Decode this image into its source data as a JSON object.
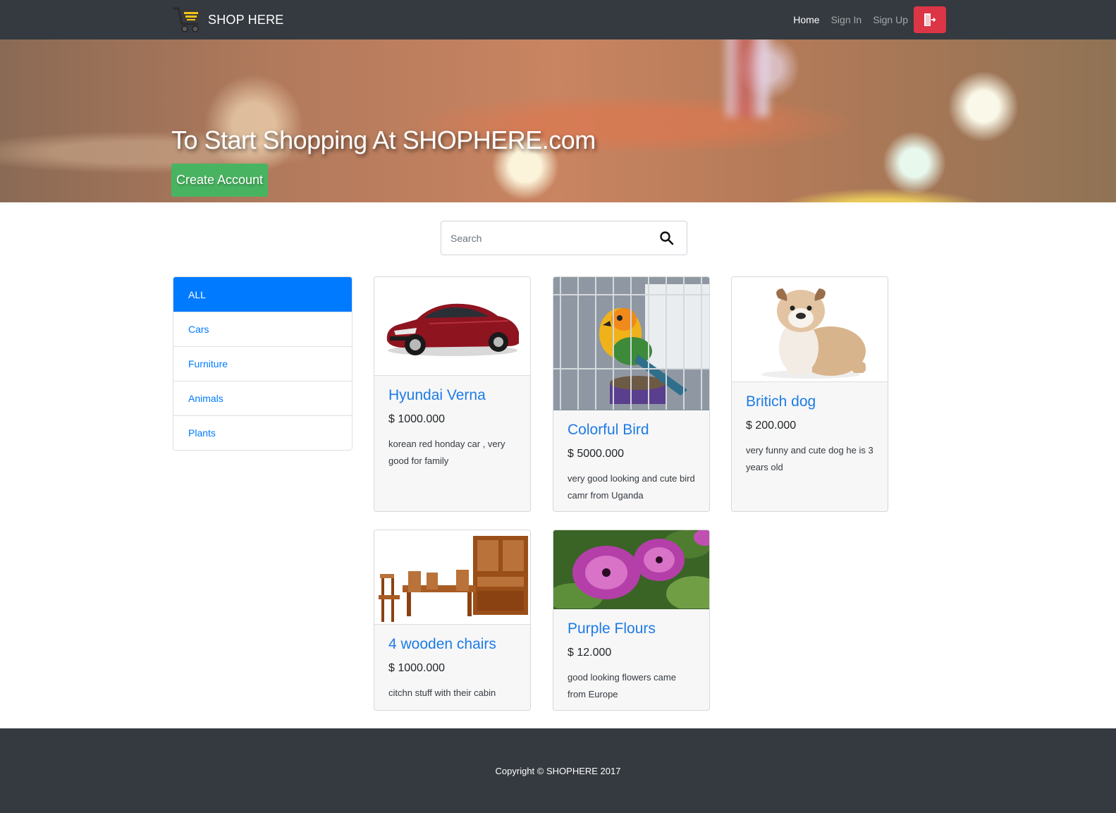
{
  "navbar": {
    "brand": "SHOP HERE",
    "links": [
      {
        "label": "Home",
        "active": true
      },
      {
        "label": "Sign In",
        "active": false
      },
      {
        "label": "Sign Up",
        "active": false
      }
    ],
    "logout_icon": "door-exit-icon"
  },
  "hero": {
    "title": "To Start Shopping At SHOPHERE.com",
    "cta": "Create Account"
  },
  "search": {
    "placeholder": "Search",
    "value": "",
    "icon": "search-icon"
  },
  "categories": [
    {
      "label": "ALL",
      "active": true
    },
    {
      "label": "Cars",
      "active": false
    },
    {
      "label": "Furniture",
      "active": false
    },
    {
      "label": "Animals",
      "active": false
    },
    {
      "label": "Plants",
      "active": false
    }
  ],
  "products": [
    {
      "title": "Hyundai Verna",
      "price": "$ 1000.000",
      "description": "korean red honday car , very good for family",
      "image": "red-car"
    },
    {
      "title": "Colorful Bird",
      "price": "$ 5000.000",
      "description": "very good looking and cute bird camr from Uganda",
      "image": "parrot-in-cage"
    },
    {
      "title": "Britich dog",
      "price": "$ 200.000",
      "description": "very funny and cute dog he is 3 years old",
      "image": "bulldog-puppy"
    },
    {
      "title": "4 wooden chairs",
      "price": "$ 1000.000",
      "description": "citchn stuff with their cabin",
      "image": "wooden-dining-set"
    },
    {
      "title": "Purple Flours",
      "price": "$ 12.000",
      "description": "good looking flowers came from Europe",
      "image": "purple-petunias"
    }
  ],
  "footer": {
    "text": "Copyright © SHOPHERE 2017"
  },
  "colors": {
    "navbar": "#343a40",
    "primary": "#007bff",
    "success": "#48b461",
    "danger": "#dc3545"
  }
}
